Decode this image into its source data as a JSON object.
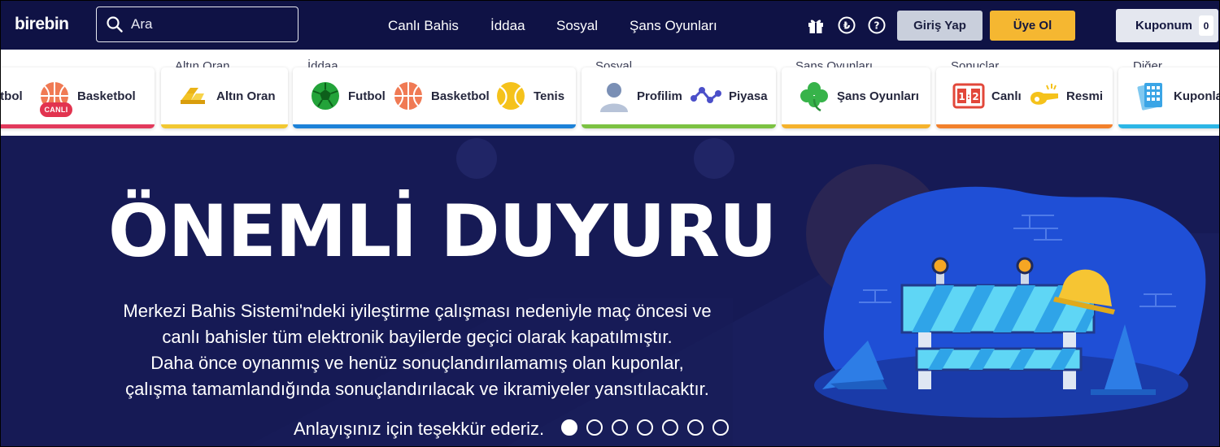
{
  "header": {
    "logo": "birebin",
    "search_placeholder": "Ara",
    "nav": [
      "Canlı Bahis",
      "İddaa",
      "Sosyal",
      "Şans Oyunları"
    ],
    "icons": [
      "gift-icon",
      "lira-coin-icon",
      "help-icon"
    ],
    "login_label": "Giriş Yap",
    "signup_label": "Üye Ol",
    "coupon_label": "Kuponum",
    "coupon_count": "0"
  },
  "categories": {
    "live": {
      "items": [
        "utbol",
        "Basketbol"
      ],
      "badge": "CANLI",
      "color": "#e23a5c"
    },
    "altin": {
      "title": "Altın Oran",
      "items": [
        "Altın Oran"
      ],
      "color": "#f2c832"
    },
    "iddaa": {
      "title": "İddaa",
      "items": [
        "Futbol",
        "Basketbol",
        "Tenis"
      ],
      "color": "#1d82d8"
    },
    "sosyal": {
      "title": "Sosyal",
      "items": [
        "Profilim",
        "Piyasa"
      ],
      "color": "#7cc242"
    },
    "sans": {
      "title": "Şans Oyunları",
      "items": [
        "Şans Oyunları"
      ],
      "color": "#f5b22c"
    },
    "sonuclar": {
      "title": "Sonuçlar",
      "items": [
        "Canlı",
        "Resmi"
      ],
      "color": "#f2812c"
    },
    "diger": {
      "title": "Diğer",
      "items": [
        "Kuponla"
      ],
      "color": "#2cb6e6"
    }
  },
  "banner": {
    "headline": "ÖNEMLİ DUYURU",
    "line1": "Merkezi Bahis Sistemi'ndeki iyileştirme çalışması nedeniyle maç öncesi ve",
    "line2": "canlı bahisler tüm elektronik bayilerde geçici olarak kapatılmıştır.",
    "line3": "Daha önce oynanmış ve henüz sonuçlandırılamamış olan kuponlar,",
    "line4": "çalışma tamamlandığında sonuçlandırılacak ve ikramiyeler yansıtılacaktır.",
    "thanks": "Anlayışınız için teşekkür ederiz.",
    "slides_total": 7,
    "active_slide": 1
  }
}
